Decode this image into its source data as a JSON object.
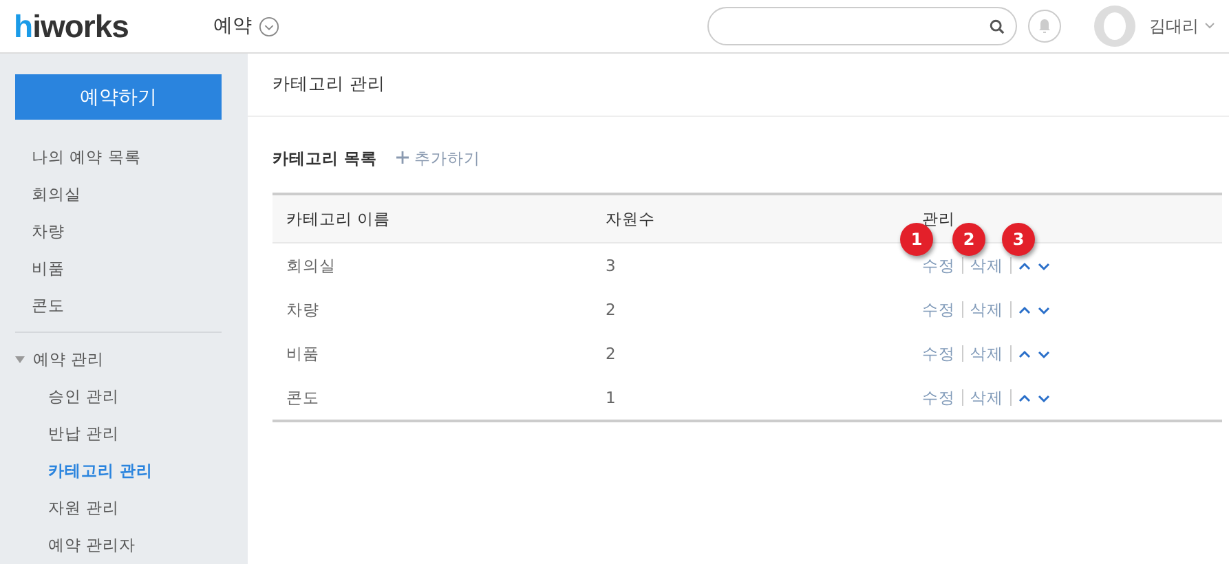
{
  "header": {
    "logo": {
      "accent": "h",
      "rest": "iworks"
    },
    "app_menu": "예약",
    "user": {
      "name": "김대리"
    }
  },
  "sidebar": {
    "primary_button": "예약하기",
    "items": [
      {
        "label": "나의 예약 목록",
        "selected": false
      },
      {
        "label": "회의실",
        "selected": false
      },
      {
        "label": "차량",
        "selected": false
      },
      {
        "label": "비품",
        "selected": false
      },
      {
        "label": "콘도",
        "selected": false
      }
    ],
    "admin": {
      "label": "예약 관리",
      "expanded": true,
      "children": [
        {
          "label": "승인 관리",
          "selected": false
        },
        {
          "label": "반납 관리",
          "selected": false
        },
        {
          "label": "카테고리 관리",
          "selected": true
        },
        {
          "label": "자원 관리",
          "selected": false
        },
        {
          "label": "예약 관리자",
          "selected": false
        }
      ]
    }
  },
  "page_title": "카테고리 관리",
  "section": {
    "title": "카테고리 목록",
    "add_label": "추가하기"
  },
  "table": {
    "columns": [
      "카테고리 이름",
      "자원수",
      "관리"
    ],
    "rows": [
      {
        "name": "회의실",
        "count": "3",
        "edit": "수정",
        "delete": "삭제"
      },
      {
        "name": "차량",
        "count": "2",
        "edit": "수정",
        "delete": "삭제"
      },
      {
        "name": "비품",
        "count": "2",
        "edit": "수정",
        "delete": "삭제"
      },
      {
        "name": "콘도",
        "count": "1",
        "edit": "수정",
        "delete": "삭제"
      }
    ]
  },
  "annotations": [
    "1",
    "2",
    "3"
  ]
}
